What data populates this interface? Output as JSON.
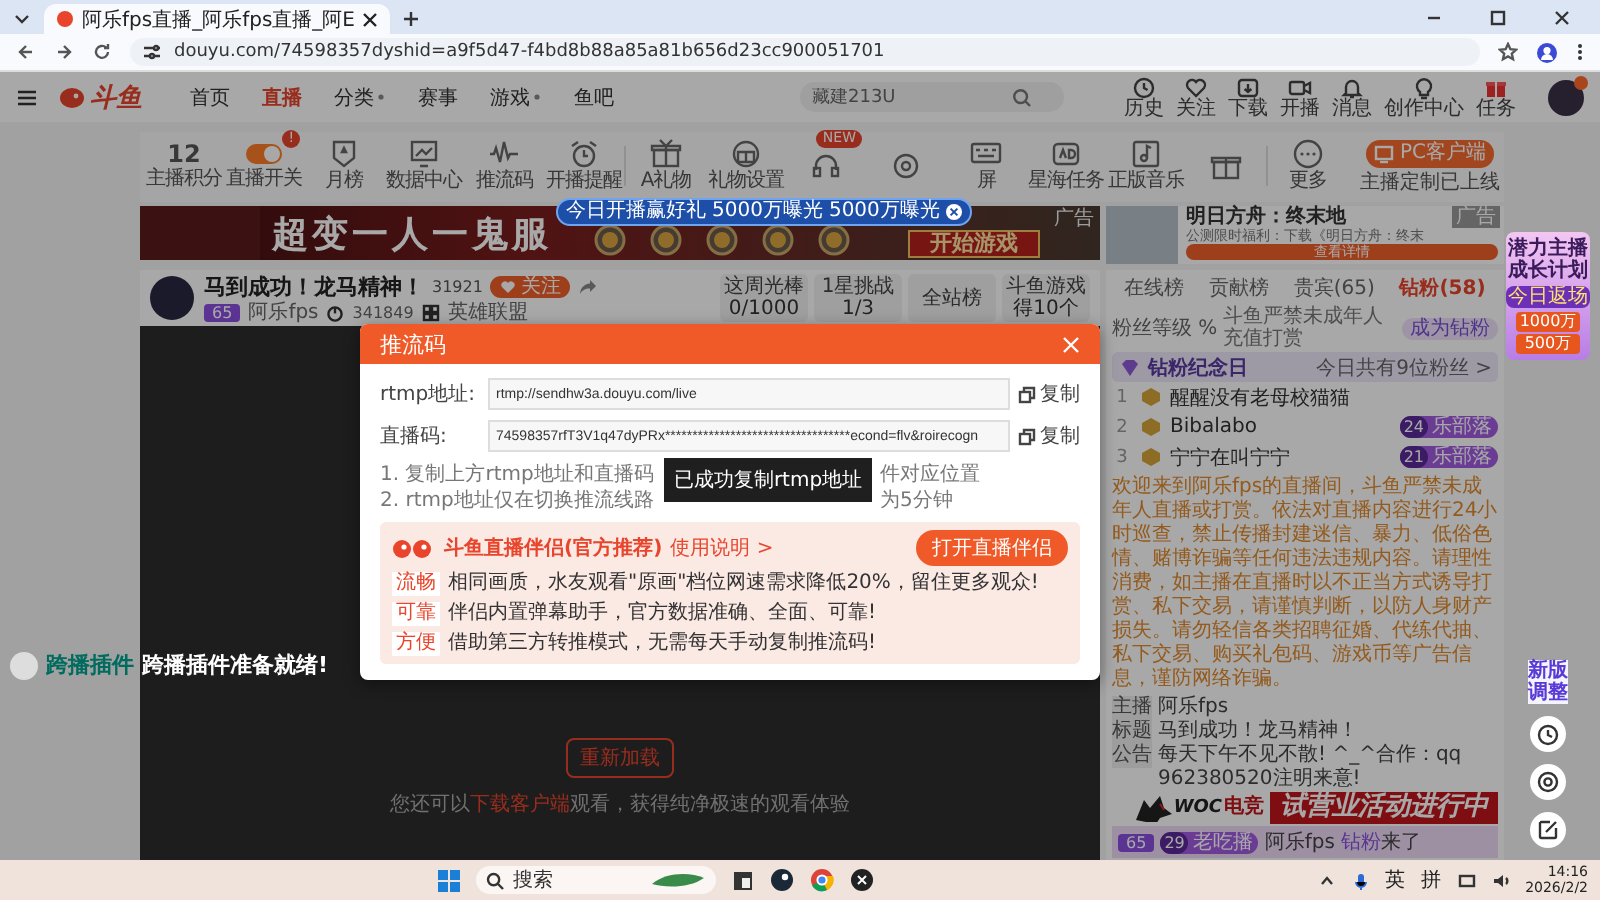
{
  "browser": {
    "tab_title": "阿乐fps直播_阿乐fps直播_阿E",
    "url": "douyu.com/74598357dyshid=a9f5d47-f4bd8b88a85a81b656d23cc900051701"
  },
  "header": {
    "logo": "斗鱼",
    "nav": [
      {
        "label": "首页",
        "selected": false,
        "dropdown": false
      },
      {
        "label": "直播",
        "selected": true,
        "dropdown": false
      },
      {
        "label": "分类",
        "selected": false,
        "dropdown": true
      },
      {
        "label": "赛事",
        "selected": false,
        "dropdown": false
      },
      {
        "label": "游戏",
        "selected": false,
        "dropdown": true
      },
      {
        "label": "鱼吧",
        "selected": false,
        "dropdown": false
      }
    ],
    "search": {
      "placeholder": "藏建213U"
    },
    "actions": [
      "历史",
      "关注",
      "下载",
      "开播",
      "消息",
      "创作中心",
      "任务"
    ]
  },
  "toolbar": {
    "items": [
      {
        "kind": "score",
        "value": "12",
        "label": "主播积分"
      },
      {
        "kind": "toggle",
        "label": "直播开关",
        "on": true,
        "badge": "!"
      },
      {
        "kind": "icon",
        "label": "月榜"
      },
      {
        "kind": "icon",
        "label": "数据中心"
      },
      {
        "kind": "icon",
        "label": "推流码"
      },
      {
        "kind": "icon",
        "label": "开播提醒"
      },
      {
        "kind": "icon",
        "label": "A礼物"
      },
      {
        "kind": "icon",
        "label": "礼物设置"
      },
      {
        "kind": "icon",
        "badge": "NEW"
      },
      {
        "kind": "icon"
      },
      {
        "kind": "icon",
        "label": "屏"
      },
      {
        "kind": "icon",
        "label": "星海任务"
      },
      {
        "kind": "icon",
        "label": "正版音乐"
      },
      {
        "kind": "icon"
      },
      {
        "kind": "icon",
        "label": "更多"
      }
    ],
    "bubble": [
      "今日开播赢好礼",
      "5000万曝光",
      "5000万曝光"
    ],
    "client_button": "PC客户端",
    "client_note": "主播定制已上线"
  },
  "banner": {
    "title": "超变一人一鬼服",
    "button": "开始游戏",
    "ad_label": "广告"
  },
  "ad_card": {
    "title": "明日方舟：终末地",
    "text": "公测限时福利：下载《明日方舟：终末",
    "button": "查看详情",
    "ad_label": "广告"
  },
  "streamer": {
    "title": "马到成功！龙马精神！",
    "count": "31921",
    "follow": "关注",
    "level": "65",
    "name": "阿乐fps",
    "heat": "341849",
    "category": "英雄联盟",
    "stats": [
      {
        "label": "这周光棒",
        "value": "0/1000"
      },
      {
        "label": "1星挑战",
        "value": "1/3"
      },
      {
        "label": "全站榜"
      },
      {
        "label": "斗鱼游戏",
        "value": "得10个"
      }
    ]
  },
  "player": {
    "reload": "重新加载",
    "hint_before": "您还可以",
    "hint_link": "下载客户端",
    "hint_after": "观看，获得纯净极速的观看体验"
  },
  "plugin_overlay": {
    "tag": "跨播插件",
    "message": "跨播插件准备就绪!"
  },
  "modal": {
    "title": "推流码",
    "fields": [
      {
        "label": "rtmp地址:",
        "value": "rtmp://sendhw3a.douyu.com/live",
        "copy": "复制"
      },
      {
        "label": "直播码:",
        "value": "74598357rfT3V1q47dyPRx**********************************econd=flv&roirecogn",
        "copy": "复制"
      }
    ],
    "steps": [
      {
        "before": "1. 复制上方rtmp地址和直播码",
        "after": "件对应位置"
      },
      {
        "before": "2. rtmp地址仅在切换推流线路",
        "after": "为5分钟"
      }
    ],
    "tooltip": "已成功复制rtmp地址",
    "partner": {
      "title": "斗鱼直播伴侣(官方推荐)",
      "help": "使用说明 >",
      "button": "打开直播伴侣",
      "rows": [
        {
          "tag": "流畅",
          "text": "相同画质，水友观看\"原画\"档位网速需求降低20%，留住更多观众!"
        },
        {
          "tag": "可靠",
          "text": "伴侣内置弹幕助手，官方数据准确、全面、可靠!"
        },
        {
          "tag": "方便",
          "text": "借助第三方转推模式，无需每天手动复制推流码!"
        }
      ]
    }
  },
  "rank": {
    "tabs": [
      {
        "label": "在线榜",
        "selected": false
      },
      {
        "label": "贡献榜",
        "selected": false
      },
      {
        "label": "贵宾(65)",
        "selected": false
      },
      {
        "label": "钻粉(58)",
        "selected": true
      }
    ],
    "fan_level": "粉丝等级 %",
    "notice": "斗鱼严禁未成年人充值打赏",
    "join": "成为钻粉",
    "anniversary": {
      "title": "钻粉纪念日",
      "count": "今日共有9位粉丝 >"
    },
    "fans": [
      {
        "rank": "1",
        "name": "醒醒没有老母校猫猫"
      },
      {
        "rank": "2",
        "name": "Bibalabo",
        "badge_level": "24",
        "badge": "乐部落"
      },
      {
        "rank": "3",
        "name": "宁宁在叫宁宁",
        "badge_level": "21",
        "badge": "乐部落"
      }
    ]
  },
  "chat": {
    "welcome": "欢迎来到阿乐fps的直播间，斗鱼严禁未成年人直播或打赏。依法对直播内容进行24小时巡查，禁止传播封建迷信、暴力、低俗色情、赌博诈骗等任何违法违规内容。请理性消费，如主播在直播时以不正当方式诱导打赏、私下交易，请谨慎判断，以防人身财产损失。请勿轻信各类招聘征婚、代练代抽、私下交易、购买礼包码、游戏币等广告信息，谨防网络诈骗。",
    "info": [
      {
        "tag": "主播",
        "text": "阿乐fps"
      },
      {
        "tag": "标题",
        "text": "马到成功！龙马精神！"
      },
      {
        "tag": "公告",
        "text": "每天下午不见不散! ^_^合作：qq 962380520注明来意!"
      }
    ],
    "entry": {
      "level": "65",
      "badge_level": "29",
      "badge": "老吃播",
      "name": "阿乐fps",
      "role": "钻粉",
      "suffix": "来了"
    }
  },
  "promo": {
    "title": "潜力主播成长计划",
    "tag": "今日返场",
    "values": [
      "1000万",
      "500万"
    ]
  },
  "event": {
    "logo": "WOC",
    "logo_sub": "电竞",
    "text": "试营业活动进行中"
  },
  "side_tools": {
    "label": "新版调整"
  },
  "taskbar": {
    "search": "搜索",
    "tray": [
      "英",
      "拼"
    ],
    "time": "14:16",
    "date": "2026/2/2"
  }
}
